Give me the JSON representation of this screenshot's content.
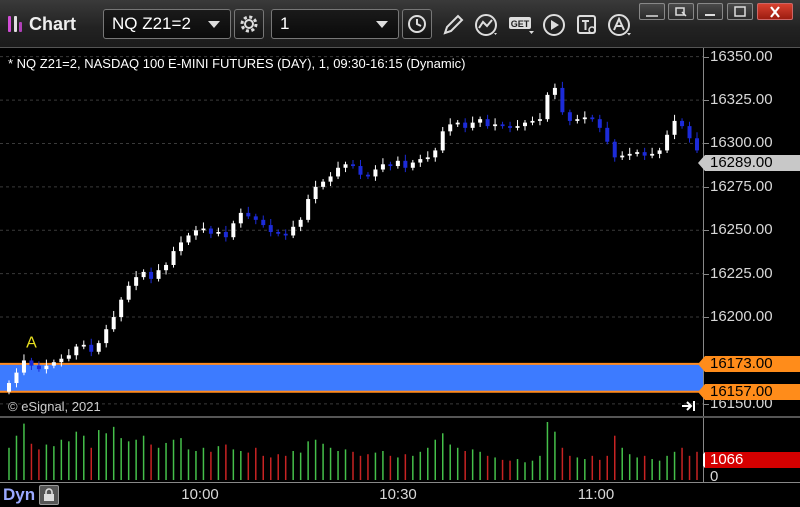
{
  "window": {
    "title": "Chart",
    "symbol_value": "NQ Z21=2",
    "interval_value": "1"
  },
  "chart": {
    "info_line": "* NQ Z21=2, NASDAQ 100 E-MINI FUTURES (DAY), 1, 09:30-16:15 (Dynamic)",
    "copyright": "© eSignal, 2021",
    "marker_label": "A",
    "mode_label": "Dyn",
    "colors": {
      "up_candle": "#ffffff",
      "down_candle": "#1c2bd8",
      "zone_fill": "#3d7bff",
      "zone_border": "#ff8a1e",
      "last_price_tag": "#c8c8c8",
      "level_tag": "#ff8c1a",
      "volume_tag": "#d40000",
      "volume_up": "#45c04a",
      "volume_down": "#c82323"
    },
    "price_tags": {
      "last": "16289.00",
      "zone_high": "16173.00",
      "zone_low": "16157.00",
      "volume": "1066"
    }
  },
  "chart_data": {
    "type": "candlestick",
    "title": "NQ Z21=2, NASDAQ 100 E-MINI FUTURES (DAY)",
    "interval": "1 minute",
    "y_ticks": [
      "16350.00",
      "16325.00",
      "16300.00",
      "16275.00",
      "16250.00",
      "16225.00",
      "16200.00",
      "16150.00"
    ],
    "y_range": [
      16143,
      16355
    ],
    "x_ticks": [
      "10:00",
      "10:30",
      "11:00"
    ],
    "volume_axis_label": "0",
    "shaded_zone": {
      "low": 16157.0,
      "high": 16173.0
    },
    "last_price": 16289.0,
    "closes": [
      16162,
      16168,
      16175,
      16172,
      16170,
      16172,
      16174,
      16176,
      16178,
      16183,
      16184,
      16180,
      16185,
      16193,
      16200,
      16210,
      16218,
      16223,
      16226,
      16222,
      16227,
      16230,
      16238,
      16243,
      16247,
      16250,
      16251,
      16248,
      16249,
      16246,
      16254,
      16260,
      16258,
      16256,
      16253,
      16249,
      16248,
      16247,
      16252,
      16256,
      16268,
      16275,
      16278,
      16281,
      16286,
      16288,
      16287,
      16282,
      16281,
      16285,
      16288,
      16287,
      16290,
      16286,
      16289,
      16291,
      16292,
      16296,
      16307,
      16311,
      16312,
      16309,
      16312,
      16314,
      16310,
      16311,
      16310,
      16309,
      16310,
      16312,
      16313,
      16314,
      16328,
      16332,
      16318,
      16313,
      16314,
      16315,
      16314,
      16309,
      16301,
      16292,
      16293,
      16294,
      16295,
      16293,
      16294,
      16296,
      16305,
      16313,
      16310,
      16303,
      16296
    ],
    "volumes": [
      40,
      55,
      70,
      45,
      38,
      44,
      42,
      50,
      48,
      60,
      55,
      40,
      62,
      58,
      66,
      52,
      48,
      50,
      55,
      44,
      40,
      46,
      50,
      52,
      38,
      36,
      40,
      35,
      42,
      44,
      38,
      36,
      34,
      40,
      30,
      28,
      32,
      30,
      36,
      34,
      48,
      50,
      45,
      40,
      36,
      38,
      35,
      30,
      32,
      34,
      36,
      30,
      28,
      32,
      30,
      35,
      40,
      50,
      58,
      44,
      40,
      36,
      38,
      35,
      30,
      28,
      25,
      24,
      26,
      22,
      24,
      30,
      72,
      60,
      40,
      30,
      28,
      26,
      30,
      25,
      30,
      55,
      40,
      32,
      28,
      30,
      26,
      24,
      30,
      35,
      40,
      30,
      35
    ]
  }
}
